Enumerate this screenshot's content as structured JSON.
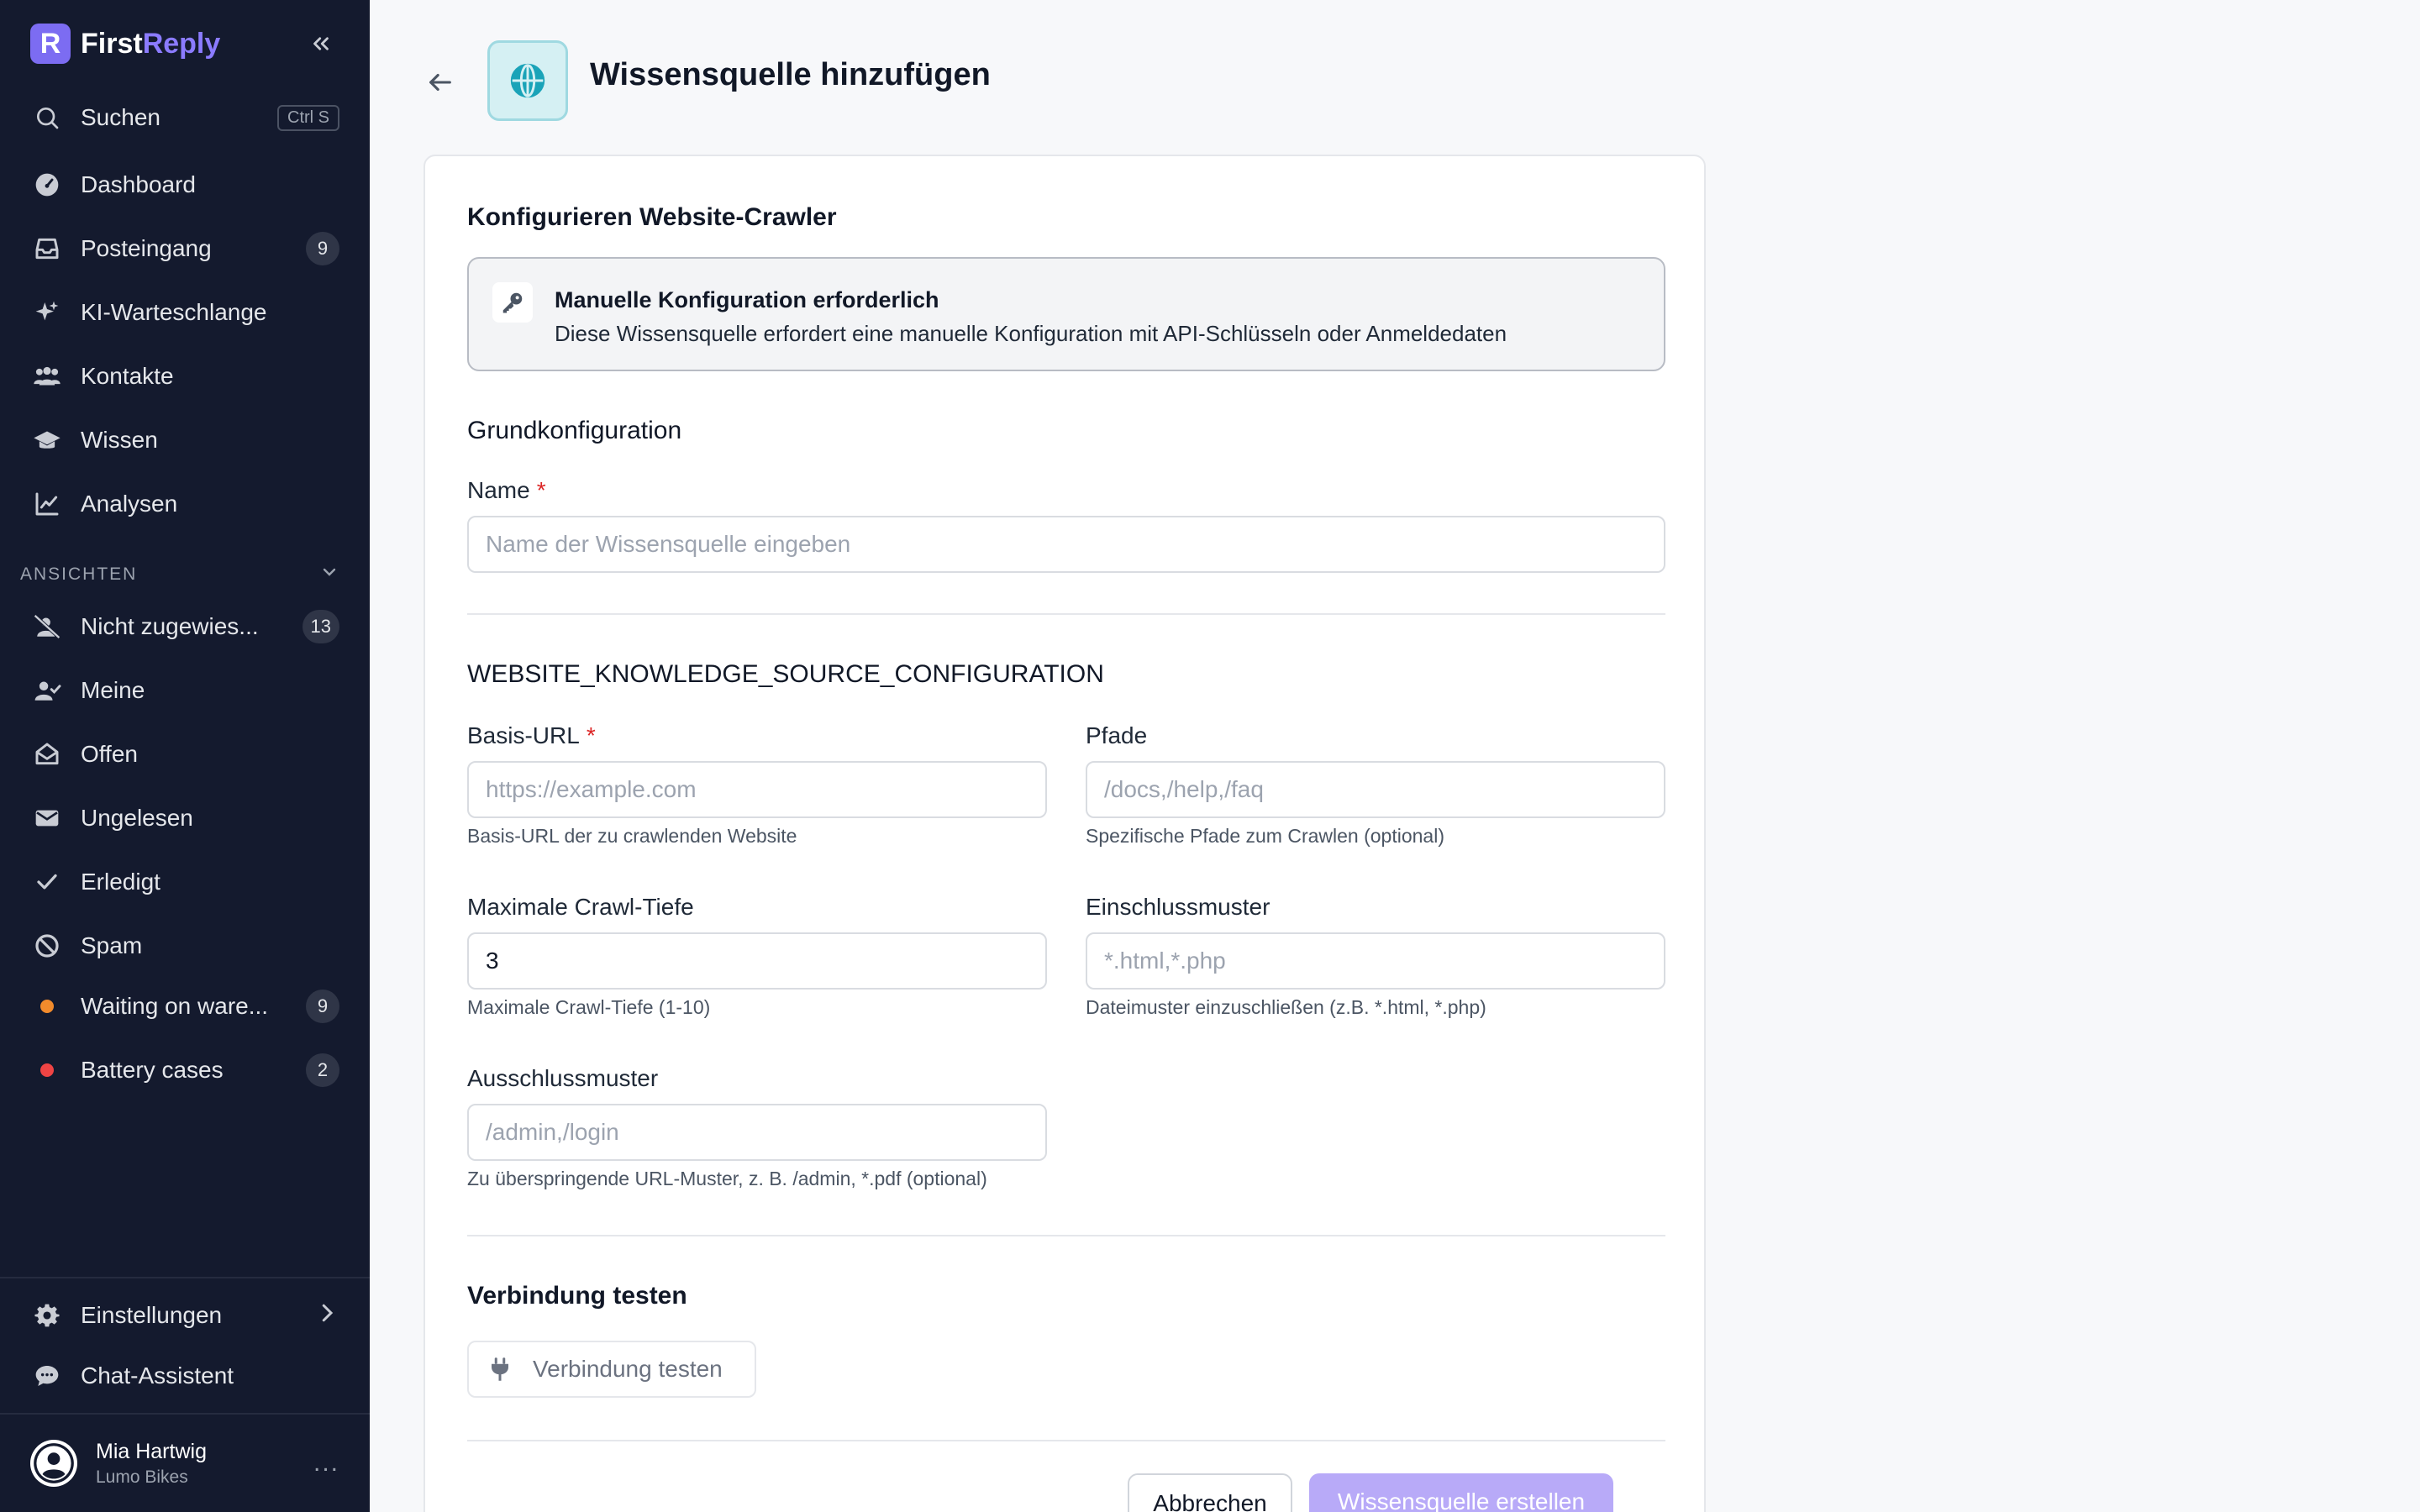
{
  "sidebar": {
    "logo": {
      "first": "First",
      "accent": "Reply",
      "mark": "R"
    },
    "search": {
      "label": "Suchen",
      "shortcut": "Ctrl S"
    },
    "nav": [
      {
        "label": "Dashboard",
        "icon": "gauge-icon"
      },
      {
        "label": "Posteingang",
        "icon": "inbox-icon",
        "badge": "9"
      },
      {
        "label": "KI-Warteschlange",
        "icon": "sparkles-icon"
      },
      {
        "label": "Kontakte",
        "icon": "users-icon"
      },
      {
        "label": "Wissen",
        "icon": "graduation-cap-icon"
      },
      {
        "label": "Analysen",
        "icon": "chart-line-icon"
      }
    ],
    "views_header": "ANSICHTEN",
    "views": [
      {
        "label": "Nicht zugewies...",
        "icon": "user-slash-icon",
        "badge": "13"
      },
      {
        "label": "Meine",
        "icon": "user-check-icon"
      },
      {
        "label": "Offen",
        "icon": "envelope-open-icon"
      },
      {
        "label": "Ungelesen",
        "icon": "envelope-icon"
      },
      {
        "label": "Erledigt",
        "icon": "check-icon"
      },
      {
        "label": "Spam",
        "icon": "ban-icon"
      },
      {
        "label": "Waiting on ware...",
        "dot_color": "#f28b2c",
        "badge": "9"
      },
      {
        "label": "Battery cases",
        "dot_color": "#ef4444",
        "badge": "2"
      }
    ],
    "settings": "Einstellungen",
    "chat_assistant": "Chat-Assistent",
    "user": {
      "name": "Mia Hartwig",
      "org": "Lumo Bikes",
      "more": "..."
    }
  },
  "page": {
    "title": "Wissensquelle hinzufügen",
    "icon": "globe-icon"
  },
  "form": {
    "section_crawler": "Konfigurieren Website-Crawler",
    "notice": {
      "title": "Manuelle Konfiguration erforderlich",
      "description": "Diese Wissensquelle erfordert eine manuelle Konfiguration mit API-Schlüsseln oder Anmeldedaten"
    },
    "section_basic": "Grundkonfiguration",
    "name": {
      "label": "Name",
      "required_mark": "*",
      "value": "",
      "placeholder": "Name der Wissensquelle eingeben"
    },
    "section_config": "WEBSITE_KNOWLEDGE_SOURCE_CONFIGURATION",
    "base_url": {
      "label": "Basis-URL",
      "required_mark": "*",
      "value": "",
      "placeholder": "https://example.com",
      "hint": "Basis-URL der zu crawlenden Website"
    },
    "paths": {
      "label": "Pfade",
      "value": "",
      "placeholder": "/docs,/help,/faq",
      "hint": "Spezifische Pfade zum Crawlen (optional)"
    },
    "max_depth": {
      "label": "Maximale Crawl-Tiefe",
      "value": "3",
      "placeholder": "",
      "hint": "Maximale Crawl-Tiefe (1-10)"
    },
    "include": {
      "label": "Einschlussmuster",
      "value": "",
      "placeholder": "*.html,*.php",
      "hint": "Dateimuster einzuschließen (z.B. *.html, *.php)"
    },
    "exclude": {
      "label": "Ausschlussmuster",
      "value": "",
      "placeholder": "/admin,/login",
      "hint": "Zu überspringende URL-Muster, z. B. /admin, *.pdf (optional)"
    },
    "section_test": "Verbindung testen",
    "test_button": "Verbindung testen",
    "cancel_button": "Abbrechen",
    "create_button": "Wissensquelle erstellen"
  },
  "colors": {
    "sidebar_bg": "#141a2e",
    "brand_accent": "#8b7bff",
    "primary_disabled": "#b8aaf8",
    "required": "#dc2626",
    "globe_icon": "#1aa3b8"
  }
}
